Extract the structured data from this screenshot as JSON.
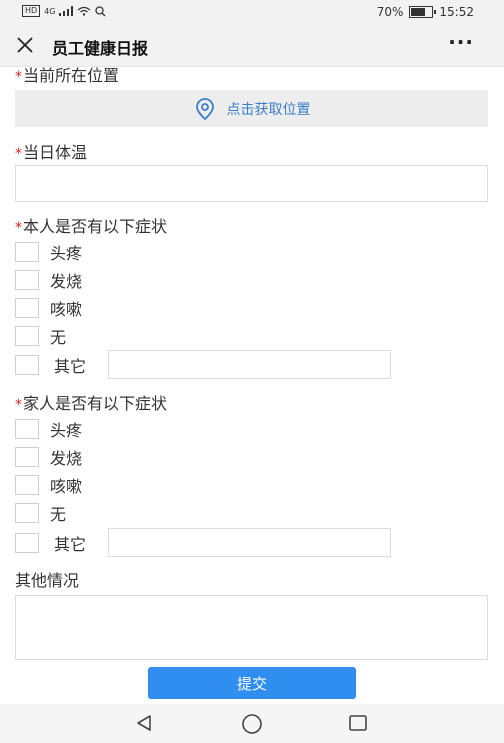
{
  "status": {
    "hd": "HD",
    "network": "4G",
    "battery_text": "70%",
    "battery_level": 0.7,
    "time": "15:52"
  },
  "header": {
    "title": "员工健康日报",
    "more": "···"
  },
  "form": {
    "location": {
      "label": "当前所在位置",
      "button": "点击获取位置"
    },
    "temperature": {
      "label": "当日体温",
      "value": ""
    },
    "self_symptoms": {
      "label": "本人是否有以下症状",
      "options": [
        "头疼",
        "发烧",
        "咳嗽",
        "无"
      ],
      "other_label": "其它",
      "other_value": ""
    },
    "family_symptoms": {
      "label": "家人是否有以下症状",
      "options": [
        "头疼",
        "发烧",
        "咳嗽",
        "无"
      ],
      "other_label": "其它",
      "other_value": ""
    },
    "other_situation": {
      "label": "其他情况",
      "value": ""
    },
    "required_mark": "*"
  },
  "submit_label": "提交",
  "colors": {
    "accent": "#2f8ef0",
    "link": "#3b7ec8",
    "required": "#e02020"
  }
}
